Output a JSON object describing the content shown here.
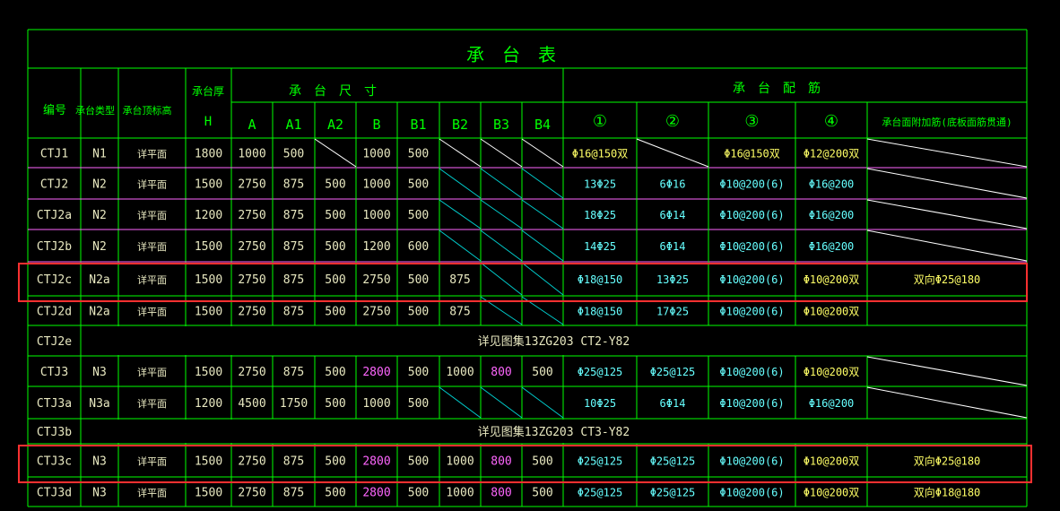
{
  "app": {
    "title": "承台表"
  },
  "colors": {
    "background": "#000000",
    "grid": "#00ff00",
    "row_rule": "#ff66ff",
    "title_text": "#00ff00",
    "head_text": "#00ff00",
    "id_text": "#e8e8c0",
    "data_text": "#e8e8c0",
    "cyan_text": "#66ffff",
    "yellow_text": "#ffff66",
    "magenta_text": "#ff66ff",
    "diagonal_white": "#ffffff",
    "diagonal_cyan": "#00cccc",
    "highlight_box": "#ff3030"
  },
  "table": {
    "title": "承　台　表",
    "headers": {
      "id": "编号",
      "type": "承台类型",
      "elev": "承台顶标高",
      "thick_top": "承台厚",
      "thick_bottom": "H",
      "dims_group": "承　台　尺　寸",
      "rebar_group": "承　台　配　筋",
      "dims": [
        "A",
        "A1",
        "A2",
        "B",
        "B1",
        "B2",
        "B3",
        "B4"
      ],
      "rebar": [
        "①",
        "②",
        "③",
        "④"
      ],
      "extra": "承台面附加筋(底板面筋贯通)"
    },
    "rows": [
      {
        "id": "CTJ1",
        "type": "N1",
        "elev": "详平面",
        "h": "1800",
        "A": "1000",
        "A1": "500",
        "A2": "",
        "B": "1000",
        "B1": "500",
        "B2": "",
        "B3": "",
        "B4": "",
        "r1": "Φ16@150双",
        "r2": "",
        "r3": "Φ16@150双",
        "r4": "Φ12@200双",
        "extra": "",
        "diag": [
          "A2",
          "B2",
          "B3",
          "B4",
          "r2",
          "extra"
        ]
      },
      {
        "id": "CTJ2",
        "type": "N2",
        "elev": "详平面",
        "h": "1500",
        "A": "2750",
        "A1": "875",
        "A2": "500",
        "B": "1000",
        "B1": "500",
        "B2": "",
        "B3": "",
        "B4": "",
        "r1": "13Φ25",
        "r2": "6Φ16",
        "r3": "Φ10@200(6)",
        "r4": "Φ16@200",
        "extra": "",
        "diag": [
          "B2",
          "B3",
          "B4",
          "extra"
        ]
      },
      {
        "id": "CTJ2a",
        "type": "N2",
        "elev": "详平面",
        "h": "1200",
        "A": "2750",
        "A1": "875",
        "A2": "500",
        "B": "1000",
        "B1": "500",
        "B2": "",
        "B3": "",
        "B4": "",
        "r1": "18Φ25",
        "r2": "6Φ14",
        "r3": "Φ10@200(6)",
        "r4": "Φ16@200",
        "extra": "",
        "diag": [
          "B2",
          "B3",
          "B4",
          "extra"
        ]
      },
      {
        "id": "CTJ2b",
        "type": "N2",
        "elev": "详平面",
        "h": "1500",
        "A": "2750",
        "A1": "875",
        "A2": "500",
        "B": "1200",
        "B1": "600",
        "B2": "",
        "B3": "",
        "B4": "",
        "r1": "14Φ25",
        "r2": "6Φ14",
        "r3": "Φ10@200(6)",
        "r4": "Φ16@200",
        "extra": "",
        "diag": [
          "B2",
          "B3",
          "B4",
          "extra"
        ]
      },
      {
        "id": "CTJ2c",
        "type": "N2a",
        "elev": "详平面",
        "h": "1500",
        "A": "2750",
        "A1": "875",
        "A2": "500",
        "B": "2750",
        "B1": "500",
        "B2": "875",
        "B3": "",
        "B4": "",
        "r1": "Φ18@150",
        "r2": "13Φ25",
        "r3": "Φ10@200(6)",
        "r4": "Φ10@200双",
        "extra": "双向Φ25@180",
        "diag": [
          "B3",
          "B4"
        ]
      },
      {
        "id": "CTJ2d",
        "type": "N2a",
        "elev": "详平面",
        "h": "1500",
        "A": "2750",
        "A1": "875",
        "A2": "500",
        "B": "2750",
        "B1": "500",
        "B2": "875",
        "B3": "",
        "B4": "",
        "r1": "Φ18@150",
        "r2": "17Φ25",
        "r3": "Φ10@200(6)",
        "r4": "Φ10@200双",
        "extra": "",
        "diag": [
          "B3",
          "B4"
        ]
      },
      {
        "id": "CTJ2e",
        "span": "详见图集13ZG203 CT2-Y82"
      },
      {
        "id": "CTJ3",
        "type": "N3",
        "elev": "详平面",
        "h": "1500",
        "A": "2750",
        "A1": "875",
        "A2": "500",
        "B": "2800",
        "B1": "500",
        "B2": "1000",
        "B3": "800",
        "B4": "500",
        "r1": "Φ25@125",
        "r2": "Φ25@125",
        "r3": "Φ10@200(6)",
        "r4": "Φ10@200双",
        "extra": "",
        "diag": [
          "extra"
        ]
      },
      {
        "id": "CTJ3a",
        "type": "N3a",
        "elev": "详平面",
        "h": "1200",
        "A": "4500",
        "A1": "1750",
        "A2": "500",
        "B": "1000",
        "B1": "500",
        "B2": "",
        "B3": "",
        "B4": "",
        "r1": "10Φ25",
        "r2": "6Φ14",
        "r3": "Φ10@200(6)",
        "r4": "Φ16@200",
        "extra": "",
        "diag": [
          "B2",
          "B3",
          "B4",
          "extra"
        ]
      },
      {
        "id": "CTJ3b",
        "span": "详见图集13ZG203 CT3-Y82"
      },
      {
        "id": "CTJ3c",
        "type": "N3",
        "elev": "详平面",
        "h": "1500",
        "A": "2750",
        "A1": "875",
        "A2": "500",
        "B": "2800",
        "B1": "500",
        "B2": "1000",
        "B3": "800",
        "B4": "500",
        "r1": "Φ25@125",
        "r2": "Φ25@125",
        "r3": "Φ10@200(6)",
        "r4": "Φ10@200双",
        "extra": "双向Φ25@180",
        "diag": []
      },
      {
        "id": "CTJ3d",
        "type": "N3",
        "elev": "详平面",
        "h": "1500",
        "A": "2750",
        "A1": "875",
        "A2": "500",
        "B": "2800",
        "B1": "500",
        "B2": "1000",
        "B3": "800",
        "B4": "500",
        "r1": "Φ25@125",
        "r2": "Φ25@125",
        "r3": "Φ10@200(6)",
        "r4": "Φ10@200双",
        "extra": "双向Φ18@180",
        "diag": []
      }
    ],
    "highlighted_rows": [
      "CTJ2c",
      "CTJ3c"
    ]
  }
}
